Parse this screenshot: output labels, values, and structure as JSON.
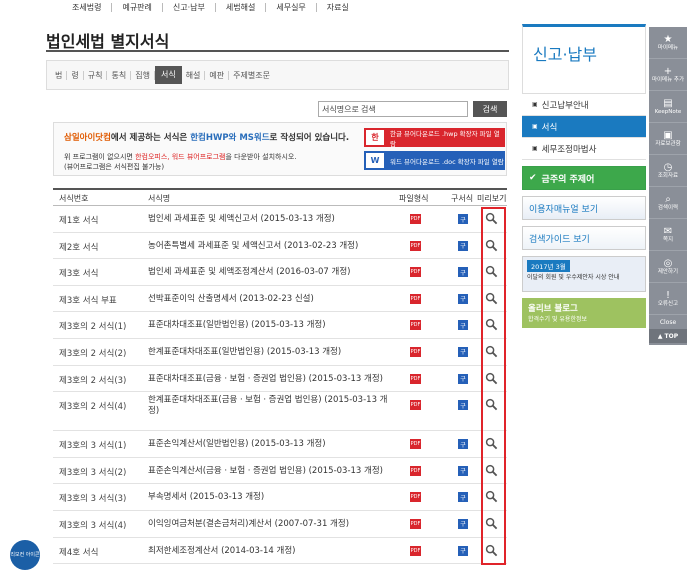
{
  "topnav": [
    "조세법령",
    "예규판례",
    "신고·납부",
    "세법해설",
    "세무실무",
    "자료실"
  ],
  "page_title": "법인세법 별지서식",
  "law_tabs": {
    "items": [
      "법",
      "령",
      "규칙",
      "통칙",
      "집행",
      "서식",
      "해설",
      "예판",
      "주제별조문"
    ],
    "active_index": 5
  },
  "search": {
    "value": "서식명으로 검색",
    "button": "검색"
  },
  "info": {
    "main_prefix": "삼일아이닷컴",
    "main_mid": "에서 제공하는 서식은 ",
    "main_formats": "한컴HWP와 MS워드",
    "main_suffix": "로 작성되어 있습니다.",
    "sub_line1_a": "위 프로그램이 없으시면 ",
    "sub_line1_b": "한컴오피스, 워드 뷰어프로그램",
    "sub_line1_c": "을 다운받아 설치하시오.",
    "sub_line2": "(뷰어프로그램은 서식편집 불가능)",
    "hwp_btn": "한글 뷰어다운로드 .hwp 확장자 파일 열람",
    "doc_btn": "워드 뷰어다운로드 .doc 확장자 파일 열람"
  },
  "table": {
    "headers": {
      "num": "서식번호",
      "name": "서식명",
      "file": "파일형식",
      "old": "구서식",
      "preview": "미리보기"
    },
    "rows": [
      {
        "num": "제1호 서식",
        "name": "법인세 과세표준 및 세액신고서 (2015-03-13 개정)",
        "pdf": true,
        "doc": true
      },
      {
        "num": "제2호 서식",
        "name": "농어촌특별세 과세표준 및 세액신고서 (2013-02-23 개정)",
        "pdf": true,
        "doc": true
      },
      {
        "num": "제3호 서식",
        "name": "법인세 과세표준 및 세액조정계산서 (2016-03-07 개정)",
        "pdf": true,
        "doc": true
      },
      {
        "num": "제3호 서식 부표",
        "name": "선박표준이익 산출명세서 (2013-02-23 신설)",
        "pdf": true,
        "doc": true
      },
      {
        "num": "제3호의 2 서식(1)",
        "name": "표준대차대조표(일반법인용) (2015-03-13 개정)",
        "pdf": true,
        "doc": true
      },
      {
        "num": "제3호의 2 서식(2)",
        "name": "한계표준대차대조표(일반법인용) (2015-03-13 개정)",
        "pdf": true,
        "doc": true
      },
      {
        "num": "제3호의 2 서식(3)",
        "name": "표준대차대조표(금융ㆍ보험ㆍ증권업 법인용) (2015-03-13 개정)",
        "pdf": true,
        "doc": true
      },
      {
        "num": "제3호의 2 서식(4)",
        "name": "한계표준대차대조표(금융ㆍ보험ㆍ증권업 법인용) (2015-03-13 개정)",
        "pdf": true,
        "doc": true,
        "two_line": true
      },
      {
        "num": "제3호의 3 서식(1)",
        "name": "표준손익계산서(일반법인용) (2015-03-13 개정)",
        "pdf": true,
        "doc": true
      },
      {
        "num": "제3호의 3 서식(2)",
        "name": "표준손익계산서(금융ㆍ보험ㆍ증권업 법인용) (2015-03-13 개정)",
        "pdf": true,
        "doc": true
      },
      {
        "num": "제3호의 3 서식(3)",
        "name": "부속명세서 (2015-03-13 개정)",
        "pdf": true,
        "doc": true
      },
      {
        "num": "제3호의 3 서식(4)",
        "name": "이익잉여금처분(결손금처리)계산서 (2007-07-31 개정)",
        "pdf": true,
        "doc": true
      },
      {
        "num": "제4호 서식",
        "name": "최저한세조정계산서 (2014-03-14 개정)",
        "pdf": true,
        "doc": true
      }
    ]
  },
  "sidebar": {
    "title": "신고·납부",
    "items": [
      {
        "label": "신고납부안내",
        "active": false
      },
      {
        "label": "서식",
        "active": true
      },
      {
        "label": "세무조정마법사",
        "active": false
      }
    ],
    "banner_focus": "금주의 주제어",
    "banner_manual": "이용자매뉴얼 보기",
    "banner_guide": "검색가이드 보기",
    "banner_event_tag": "2017년 3월",
    "banner_event_text": "이달의 회원 및 우수제안자 시상 안내",
    "banner_blog_title": "올리브 블로그",
    "banner_blog_sub": "합격수기 및 유용한정보"
  },
  "quickbar": {
    "items": [
      {
        "icon": "★",
        "label": "마이메뉴"
      },
      {
        "icon": "+",
        "label": "마이메뉴 추가"
      },
      {
        "icon": "▤",
        "label": "KeepNote"
      },
      {
        "icon": "▣",
        "label": "자료보관함"
      },
      {
        "icon": "◷",
        "label": "조회자료"
      },
      {
        "icon": "⌕",
        "label": "검색이력"
      },
      {
        "icon": "✉",
        "label": "쪽지"
      },
      {
        "icon": "◎",
        "label": "제안하기"
      },
      {
        "icon": "!",
        "label": "오류신고"
      }
    ],
    "close": "Close",
    "top": "▲ TOP"
  },
  "fab": "리모컨 아이콘",
  "colors": {
    "accent": "#1a7ac0",
    "preview_highlight": "#e0242a",
    "pdf": "#d9262d",
    "doc": "#2560b8"
  }
}
